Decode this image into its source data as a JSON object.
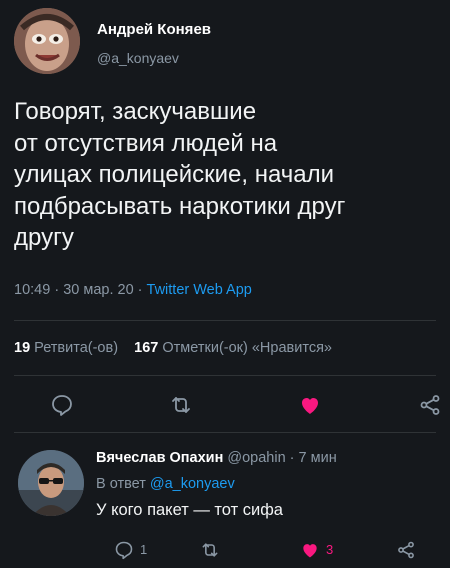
{
  "tweet": {
    "author_name": "Андрей Коняев",
    "author_handle": "@a_konyaev",
    "lines": [
      "Говорят, заскучавшие",
      "от отсутствия людей на",
      "улицах полицейские, начали",
      "подбрасывать наркотики друг",
      "другу"
    ],
    "time": "10:49",
    "date": "30 мар. 20",
    "app": "Twitter Web App",
    "retweets_count": "19",
    "retweets_label": "Ретвита(-ов)",
    "likes_count": "167",
    "likes_label": "Отметки(-ок) «Нравится»"
  },
  "actions": {
    "reply_icon": "comment-icon",
    "retweet_icon": "retweet-icon",
    "like_icon": "heart-icon",
    "share_icon": "share-icon"
  },
  "reply": {
    "author_name": "Вячеслав Опахин",
    "author_handle": "@opahin",
    "time_ago": "7 мин",
    "reply_prefix": "В ответ",
    "reply_to": "@a_konyaev",
    "text": "У кого пакет — тот сифа",
    "reply_count": "1",
    "like_count": "3"
  },
  "colors": {
    "background": "#15181c",
    "accent": "#1d9bf0",
    "like": "#f91880",
    "muted": "#8b98a5"
  }
}
